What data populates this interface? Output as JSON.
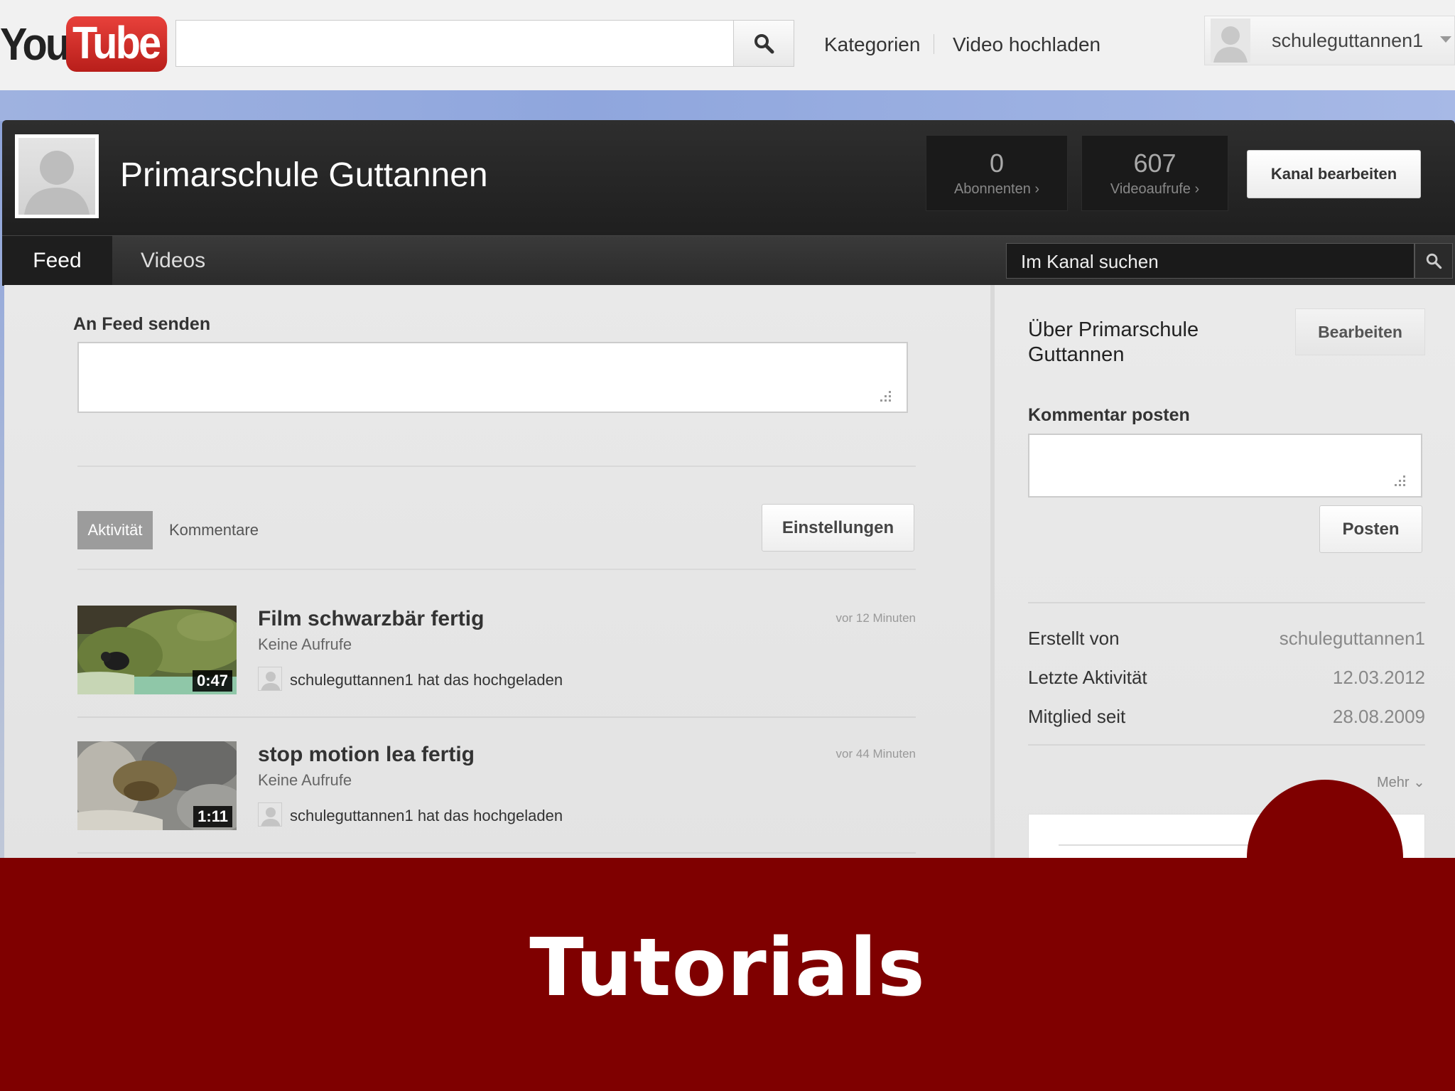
{
  "topbar": {
    "logo_you": "You",
    "logo_tube": "Tube",
    "search_placeholder": "",
    "nav": {
      "categories": "Kategorien",
      "upload": "Video hochladen"
    },
    "username": "schuleguttannen1"
  },
  "channel": {
    "title": "Primarschule Guttannen",
    "stats": [
      {
        "value": "0",
        "label": "Abonnenten ›"
      },
      {
        "value": "607",
        "label": "Videoaufrufe ›"
      }
    ],
    "edit_button": "Kanal bearbeiten",
    "tabs": [
      "Feed",
      "Videos"
    ],
    "active_tab": "Feed",
    "search_placeholder": "Im Kanal suchen"
  },
  "feed": {
    "post_label": "An Feed senden",
    "filters": {
      "active": "Aktivität",
      "comments": "Kommentare"
    },
    "settings_button": "Einstellungen",
    "items": [
      {
        "title": "Film schwarzbär fertig",
        "views": "Keine Aufrufe",
        "time": "vor 12 Minuten",
        "duration": "0:47",
        "uploader_text": "schuleguttannen1 hat das hochgeladen"
      },
      {
        "title": "stop motion lea fertig",
        "views": "Keine Aufrufe",
        "time": "vor 44 Minuten",
        "duration": "1:11",
        "uploader_text": "schuleguttannen1 hat das hochgeladen"
      }
    ]
  },
  "sidebar": {
    "about_title": "Über Primarschule Guttannen",
    "edit_button": "Bearbeiten",
    "comment_label": "Kommentar posten",
    "post_button": "Posten",
    "info": [
      {
        "label": "Erstellt von",
        "value": "schuleguttannen1"
      },
      {
        "label": "Letzte Aktivität",
        "value": "12.03.2012"
      },
      {
        "label": "Mitglied seit",
        "value": "28.08.2009"
      }
    ],
    "more": "Mehr ⌄"
  },
  "banner": {
    "title": "Tutorials"
  },
  "colors": {
    "banner": "#7f0000",
    "logo_red": "#d52a24",
    "header_dark": "#262626"
  }
}
